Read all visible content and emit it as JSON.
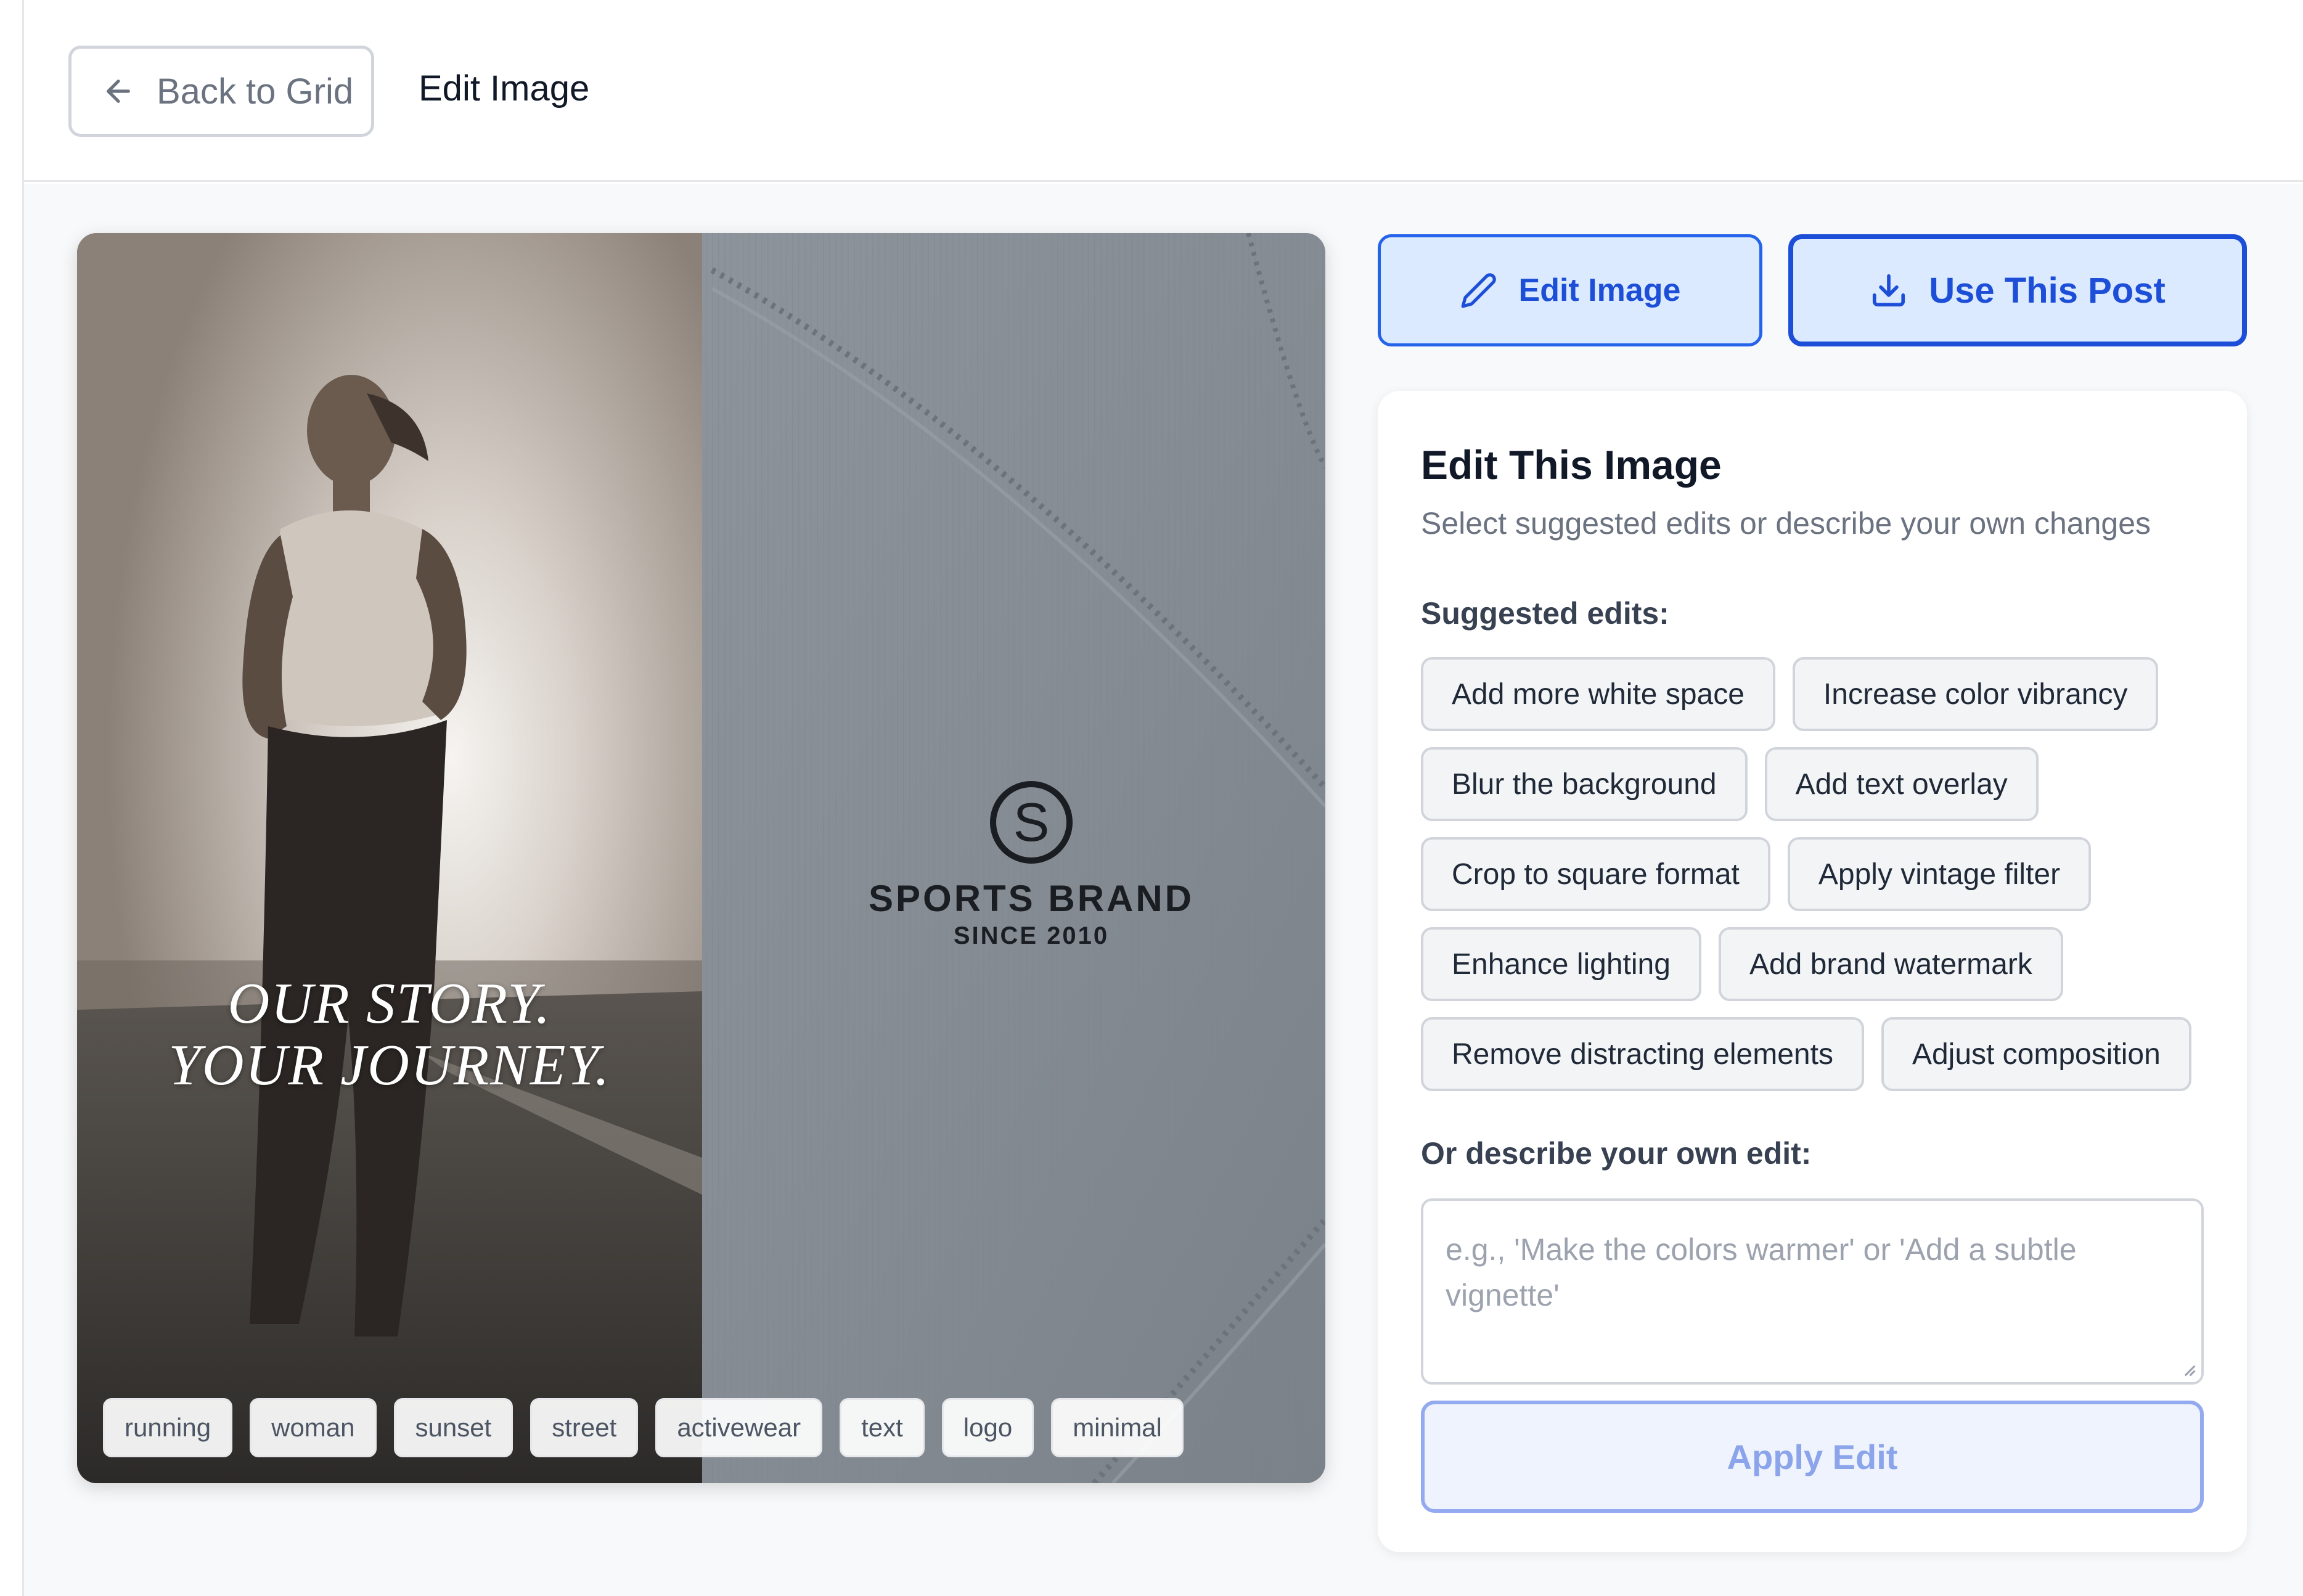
{
  "header": {
    "back_label": "Back to Grid",
    "title": "Edit Image"
  },
  "preview": {
    "overlay_line1": "OUR STORY.",
    "overlay_line2": "YOUR JOURNEY.",
    "brand_name": "SPORTS BRAND",
    "brand_since": "SINCE 2010",
    "logo_letter": "S",
    "tags": [
      "running",
      "woman",
      "sunset",
      "street",
      "activewear",
      "text",
      "logo",
      "minimal"
    ]
  },
  "actions": {
    "edit_label": "Edit Image",
    "use_label": "Use This Post"
  },
  "panel": {
    "title": "Edit This Image",
    "subtitle": "Select suggested edits or describe your own changes",
    "suggested_label": "Suggested edits:",
    "suggestions": [
      "Add more white space",
      "Increase color vibrancy",
      "Blur the background",
      "Add text overlay",
      "Crop to square format",
      "Apply vintage filter",
      "Enhance lighting",
      "Add brand watermark",
      "Remove distracting elements",
      "Adjust composition"
    ],
    "custom_label": "Or describe your own edit:",
    "custom_placeholder": "e.g., 'Make the colors warmer' or 'Add a subtle vignette'",
    "apply_label": "Apply Edit"
  },
  "colors": {
    "accent": "#1d4ed8",
    "accent_light": "#dbeafe",
    "disabled_text": "#8ba4ea"
  },
  "icons": [
    "arrow-left-icon",
    "pencil-icon",
    "download-icon",
    "resize-grip-icon"
  ]
}
